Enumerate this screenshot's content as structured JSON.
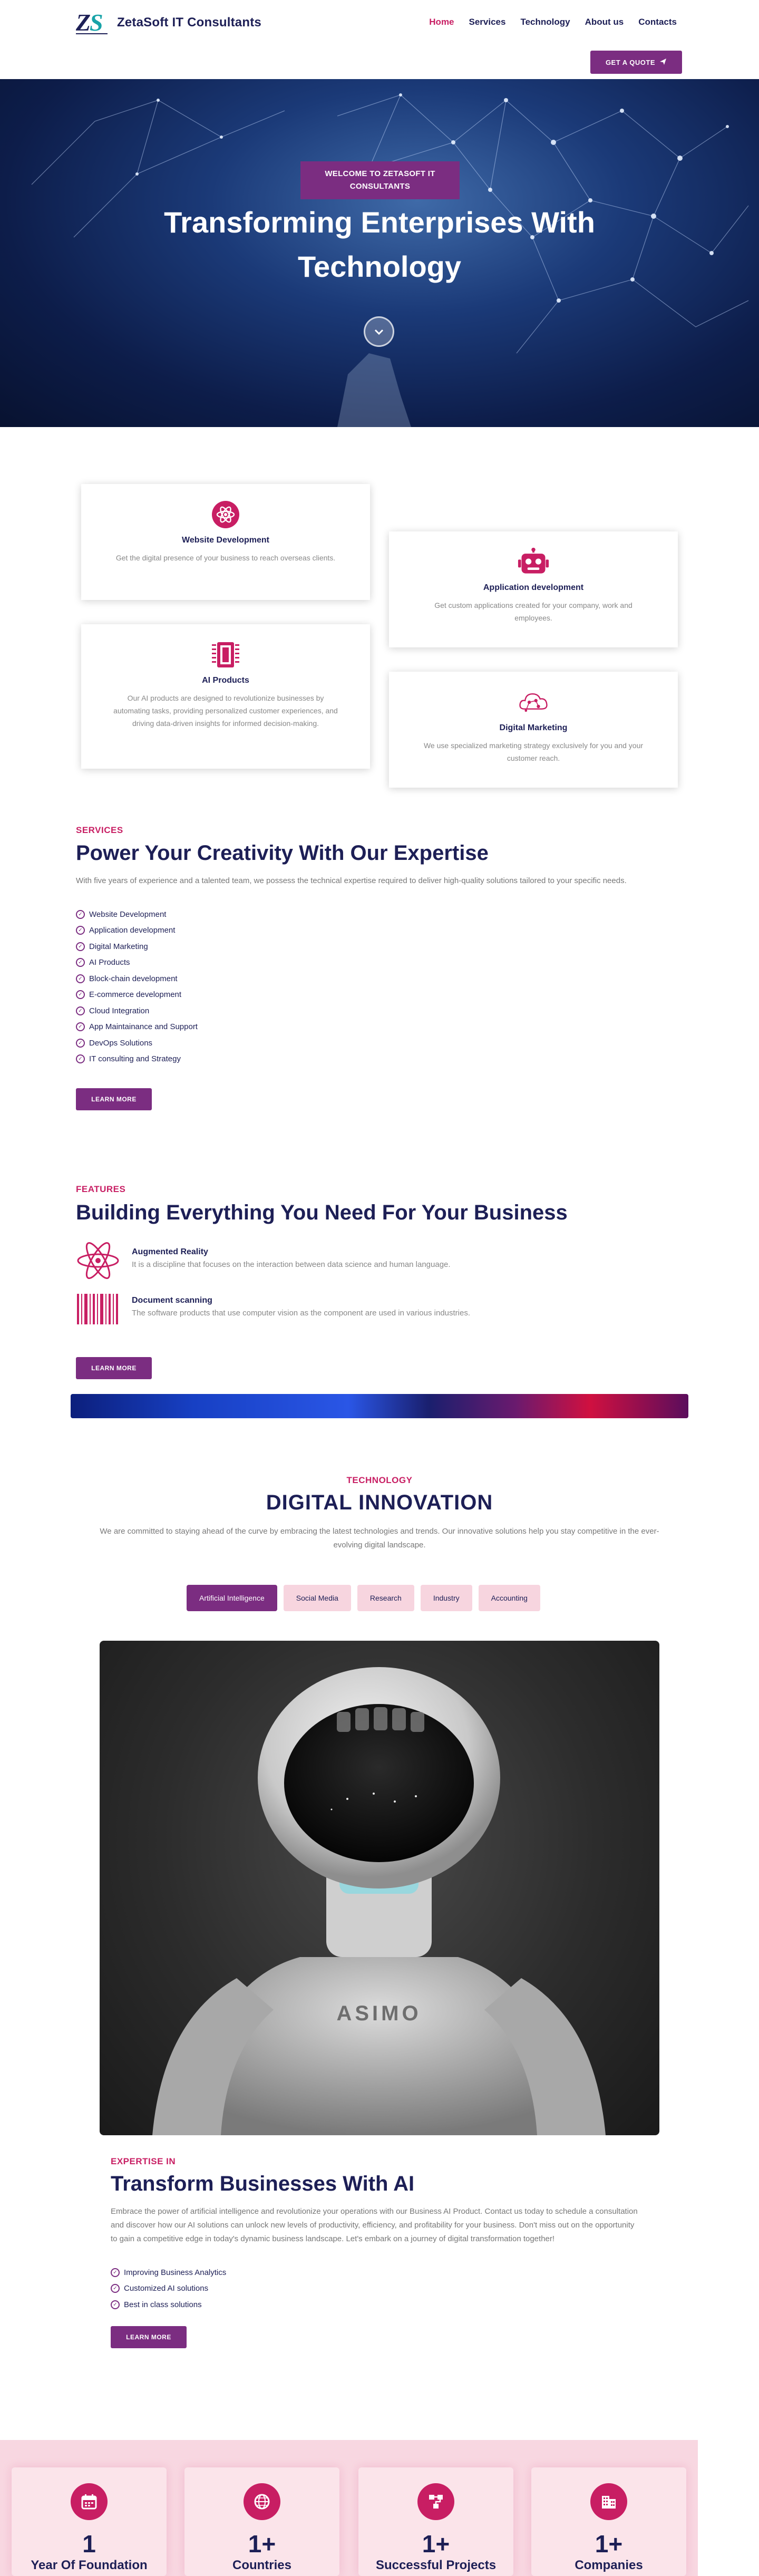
{
  "header": {
    "logo_text": "ZetaSoft IT Consultants",
    "logo_mark": "ZS",
    "nav": [
      {
        "label": "Home",
        "active": true
      },
      {
        "label": "Services",
        "active": false
      },
      {
        "label": "Technology",
        "active": false
      },
      {
        "label": "About us",
        "active": false
      },
      {
        "label": "Contacts",
        "active": false
      }
    ],
    "quote_button": "GET A QUOTE",
    "quote_icon": "paper-plane-icon"
  },
  "hero": {
    "badge": "WELCOME TO ZETASOFT IT CONSULTANTS",
    "title": "Transforming Enterprises With Technology",
    "scroll_icon": "chevron-down-icon"
  },
  "service_cards": [
    {
      "title": "Website Development",
      "text": "Get the digital presence of your business to reach overseas clients.",
      "icon": "atom-icon"
    },
    {
      "title": "Application development",
      "text": "Get custom applications created for your company, work and employees.",
      "icon": "robot-icon"
    },
    {
      "title": "AI Products",
      "text": "Our AI products are designed to revolutionize businesses by automating tasks, providing personalized customer experiences, and driving data-driven insights for informed decision-making.",
      "icon": "chip-icon"
    },
    {
      "title": "Digital Marketing",
      "text": "We use specialized marketing strategy exclusively for you and your customer reach.",
      "icon": "cloud-network-icon"
    }
  ],
  "services": {
    "eyebrow": "SERVICES",
    "title": "Power Your Creativity With Our Expertise",
    "text": "With five years of experience and a talented team, we possess the technical expertise required to deliver high-quality solutions tailored to your specific needs.",
    "list": [
      "Website Development",
      "Application development",
      "Digital Marketing",
      "AI Products",
      "Block-chain development",
      "E-commerce development",
      "Cloud Integration",
      "App Maintainance and Support",
      "DevOps Solutions",
      "IT consulting and Strategy"
    ],
    "button": "LEARN MORE"
  },
  "features": {
    "eyebrow": "FEATURES",
    "title": "Building Everything You Need For Your Business",
    "items": [
      {
        "title": "Augmented Reality",
        "text": "It is a discipline that focuses on the interaction between data science and human language.",
        "icon": "atom-icon"
      },
      {
        "title": "Document scanning",
        "text": "The software products that use computer vision as the component are used in various industries.",
        "icon": "barcode-icon"
      }
    ],
    "button": "LEARN MORE"
  },
  "technology": {
    "eyebrow": "TECHNOLOGY",
    "title": "DIGITAL INNOVATION",
    "text": "We are committed to staying ahead of the curve by embracing the latest technologies and trends. Our innovative solutions help you stay competitive in the ever-evolving digital landscape.",
    "tabs": [
      {
        "label": "Artificial Intelligence",
        "active": true
      },
      {
        "label": "Social Media",
        "active": false
      },
      {
        "label": "Research",
        "active": false
      },
      {
        "label": "Industry",
        "active": false
      },
      {
        "label": "Accounting",
        "active": false
      }
    ],
    "robot_label": "ASIMO"
  },
  "expertise": {
    "eyebrow": "EXPERTISE IN",
    "title": "Transform Businesses With AI",
    "text": "Embrace the power of artificial intelligence and revolutionize your operations with our Business AI Product. Contact us today to schedule a consultation and discover how our AI solutions can unlock new levels of productivity, efficiency, and profitability for your business. Don't miss out on the opportunity to gain a competitive edge in today's dynamic business landscape. Let's embark on a journey of digital transformation together!",
    "list": [
      "Improving Business Analytics",
      "Customized AI solutions",
      "Best in class solutions"
    ],
    "button": "LEARN MORE"
  },
  "stats": [
    {
      "number": "1",
      "label": "Year Of Foundation",
      "icon": "calendar-icon"
    },
    {
      "number": "1+",
      "label": "Countries",
      "icon": "globe-icon"
    },
    {
      "number": "1+",
      "label": "Successful Projects",
      "icon": "sitemap-icon"
    },
    {
      "number": "1+",
      "label": "Companies",
      "icon": "building-icon"
    }
  ],
  "colors": {
    "brand_purple": "#7b2d81",
    "accent_pink": "#c81e63",
    "navy": "#1d1f56"
  }
}
